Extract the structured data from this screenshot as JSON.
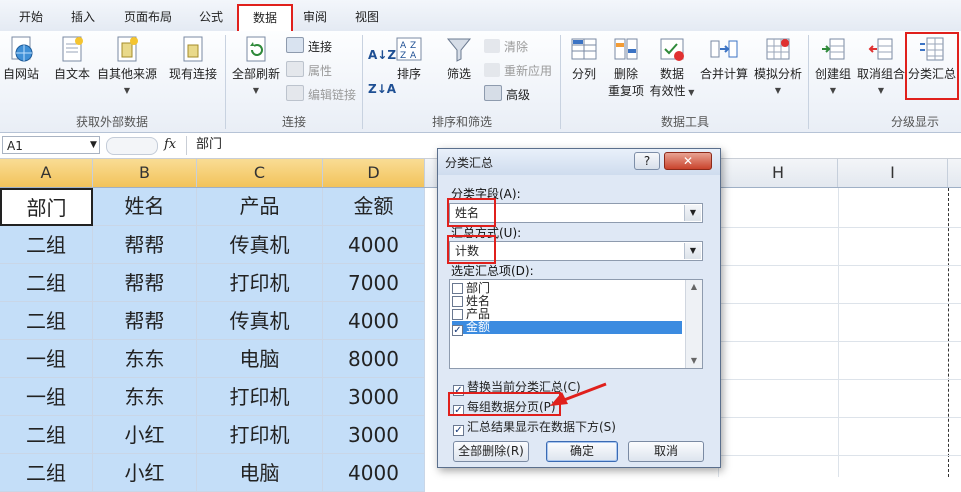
{
  "tabs": [
    "开始",
    "插入",
    "页面布局",
    "公式",
    "数据",
    "审阅",
    "视图"
  ],
  "ribbon": {
    "ext_data": {
      "web": "自网站",
      "text": "自文本",
      "other": "自其他来源",
      "existing": "现有连接",
      "label": "获取外部数据"
    },
    "connections": {
      "refresh_all": "全部刷新",
      "connections": "连接",
      "properties": "属性",
      "edit_links": "编辑链接",
      "label": "连接"
    },
    "sort_filter": {
      "sort": "排序",
      "filter": "筛选",
      "clear": "清除",
      "reapply": "重新应用",
      "advanced": "高级",
      "label": "排序和筛选"
    },
    "data_tools": {
      "text_to_col": "分列",
      "remove_dup_1": "删除",
      "remove_dup_2": "重复项",
      "validation_1": "数据",
      "validation_2": "有效性",
      "consolidate": "合并计算",
      "whatif": "模拟分析",
      "label": "数据工具"
    },
    "outline": {
      "group": "创建组",
      "ungroup": "取消组合",
      "subtotal": "分类汇总",
      "label": "分级显示"
    }
  },
  "formula_bar": {
    "name_box": "A1",
    "fx": "fx",
    "content": "部门"
  },
  "columns": [
    "A",
    "B",
    "C",
    "D",
    "H",
    "I"
  ],
  "sheet": {
    "headers": [
      "部门",
      "姓名",
      "产品",
      "金额"
    ],
    "rows": [
      [
        "二组",
        "帮帮",
        "传真机",
        "4000"
      ],
      [
        "二组",
        "帮帮",
        "打印机",
        "7000"
      ],
      [
        "二组",
        "帮帮",
        "传真机",
        "4000"
      ],
      [
        "一组",
        "东东",
        "电脑",
        "8000"
      ],
      [
        "一组",
        "东东",
        "打印机",
        "3000"
      ],
      [
        "二组",
        "小红",
        "打印机",
        "3000"
      ],
      [
        "二组",
        "小红",
        "电脑",
        "4000"
      ]
    ]
  },
  "dialog": {
    "title": "分类汇总",
    "help": "?",
    "close": "✕",
    "group_by_label": "分类字段(A):",
    "group_by_value": "姓名",
    "function_label": "汇总方式(U):",
    "function_value": "计数",
    "items_label": "选定汇总项(D):",
    "items": [
      {
        "label": "部门",
        "checked": false
      },
      {
        "label": "姓名",
        "checked": false
      },
      {
        "label": "产品",
        "checked": false
      },
      {
        "label": "金额",
        "checked": true
      }
    ],
    "replace_current": "替换当前分类汇总(C)",
    "page_break": "每组数据分页(P)",
    "summary_below": "汇总结果显示在数据下方(S)",
    "remove_all": "全部删除(R)",
    "ok": "确定",
    "cancel": "取消"
  },
  "colors": {
    "accent_red": "#e0201c",
    "cell_fill": "#c4def8",
    "selected_item": "#3b8be0"
  }
}
